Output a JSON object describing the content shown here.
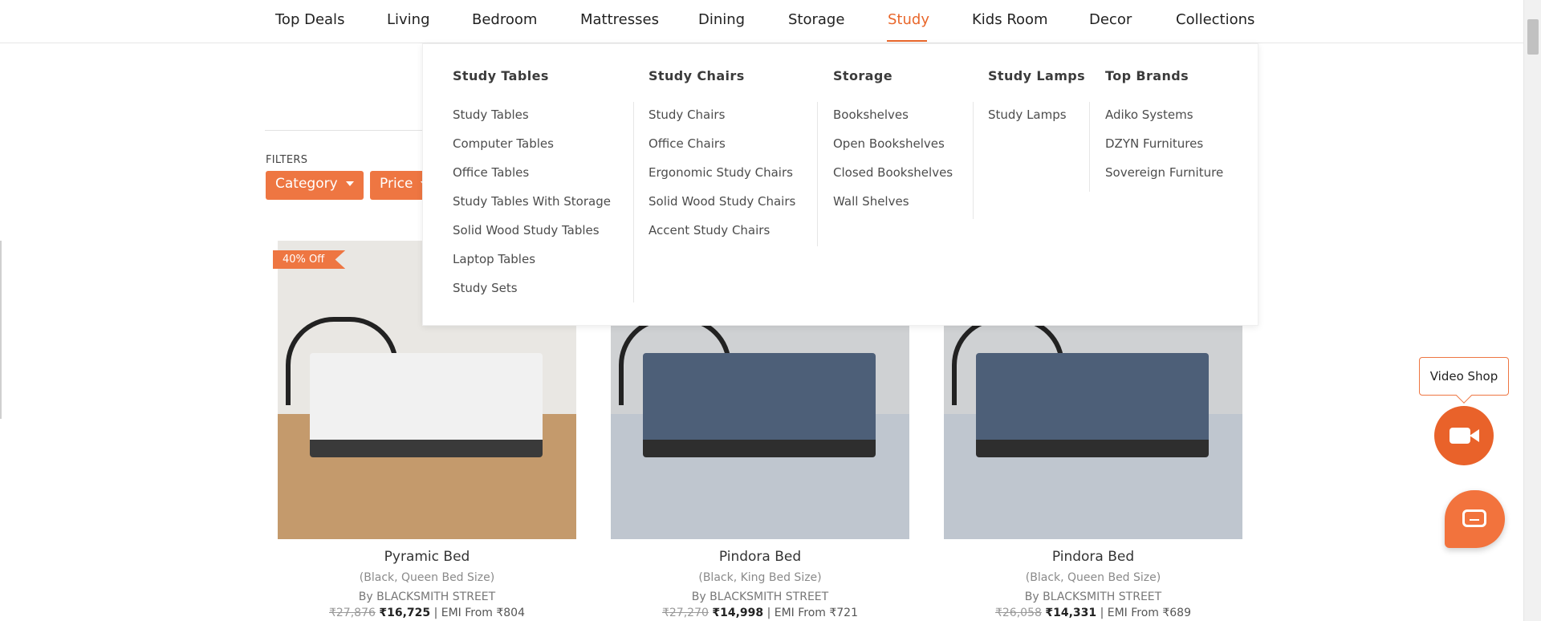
{
  "nav": {
    "items": [
      "Top Deals",
      "Living",
      "Bedroom",
      "Mattresses",
      "Dining",
      "Storage",
      "Study",
      "Kids Room",
      "Decor",
      "Collections"
    ],
    "active": "Study",
    "accent_color": "#e9672b"
  },
  "filters": {
    "label": "FILTERS",
    "buttons": [
      "Category",
      "Price"
    ]
  },
  "mega_menu": {
    "columns": [
      {
        "heading": "Study Tables",
        "items": [
          "Study Tables",
          "Computer Tables",
          "Office Tables",
          "Study Tables With Storage",
          "Solid Wood Study Tables",
          "Laptop Tables",
          "Study Sets"
        ]
      },
      {
        "heading": "Study Chairs",
        "items": [
          "Study Chairs",
          "Office Chairs",
          "Ergonomic Study Chairs",
          "Solid Wood Study Chairs",
          "Accent Study Chairs"
        ]
      },
      {
        "heading": "Storage",
        "items": [
          "Bookshelves",
          "Open Bookshelves",
          "Closed Bookshelves",
          "Wall Shelves"
        ]
      },
      {
        "heading": "Study Lamps",
        "items": [
          "Study Lamps"
        ]
      },
      {
        "heading": "Top Brands",
        "items": [
          "Adiko Systems",
          "DZYN Furnitures",
          "Sovereign Furniture"
        ]
      }
    ]
  },
  "products": [
    {
      "title": "Pyramic Bed",
      "variant": "(Black, Queen Bed Size)",
      "brand": "By BLACKSMITH STREET",
      "mrp": "₹27,876",
      "price": "₹16,725",
      "emi": "| EMI From ₹804",
      "badge": "40% Off"
    },
    {
      "title": "Pindora Bed",
      "variant": "(Black, King Bed Size)",
      "brand": "By BLACKSMITH STREET",
      "mrp": "₹27,270",
      "price": "₹14,998",
      "emi": "| EMI From ₹721"
    },
    {
      "title": "Pindora Bed",
      "variant": "(Black, Queen Bed Size)",
      "brand": "By BLACKSMITH STREET",
      "mrp": "₹26,058",
      "price": "₹14,331",
      "emi": "| EMI From ₹689"
    }
  ],
  "video_shop": {
    "label": "Video Shop",
    "icon": "video-camera-icon"
  },
  "chat": {
    "icon": "chat-icon"
  }
}
